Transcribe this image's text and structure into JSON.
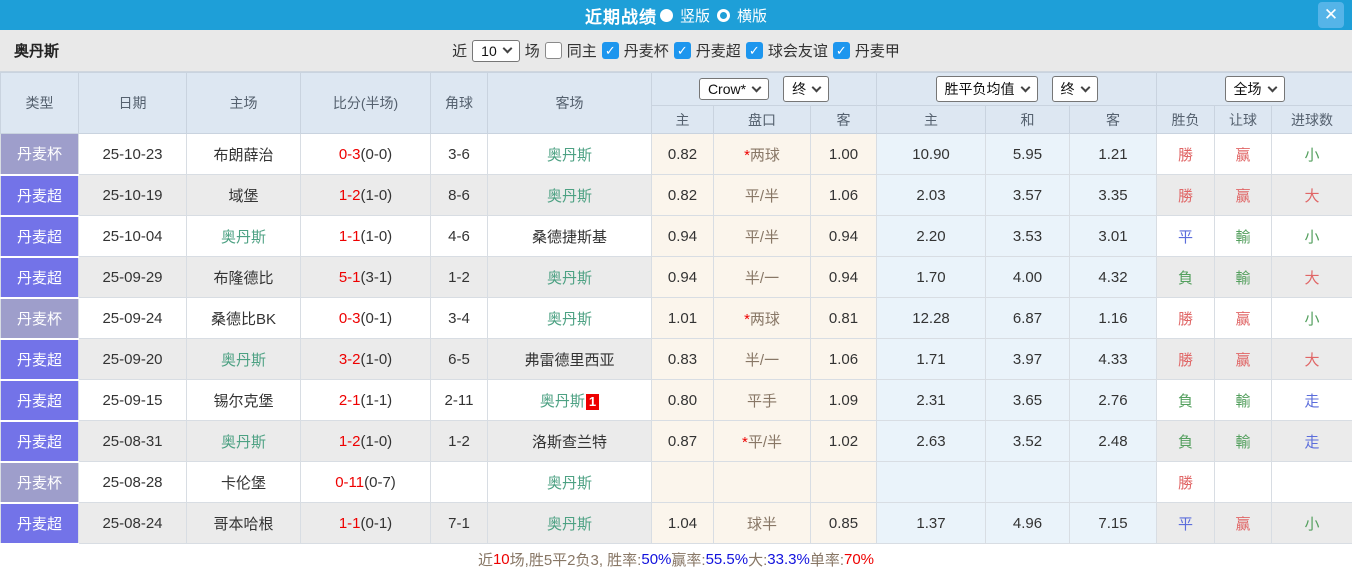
{
  "topbar": {
    "title": "近期战绩",
    "radio_vertical_label": "竖版",
    "radio_horizontal_label": "横版",
    "close_glyph": "✕"
  },
  "filter": {
    "team": "奥丹斯",
    "near_label": "近",
    "matches_value": "10",
    "matches_label": "场",
    "same_home_label": "同主",
    "league_checkboxes": [
      "丹麦杯",
      "丹麦超",
      "球会友谊",
      "丹麦甲"
    ],
    "check_glyph": "✓"
  },
  "table": {
    "left_headers": [
      "类型",
      "日期",
      "主场",
      "比分(半场)",
      "角球",
      "客场"
    ],
    "dropdowns": {
      "asia_company": "Crow*",
      "asia_time": "终",
      "europe_company": "胜平负均值",
      "europe_time": "终",
      "scope": "全场"
    },
    "sub_headers": [
      "主",
      "盘口",
      "客",
      "主",
      "和",
      "客",
      "胜负",
      "让球",
      "进球数"
    ],
    "rows": [
      {
        "type": "丹麦杯",
        "type_color": "#9e9ecb",
        "date": "25-10-23",
        "home": "布朗薛治",
        "home_team": false,
        "score": "0-3",
        "half": "(0-0)",
        "corner": "3-6",
        "away": "奥丹斯",
        "away_team": true,
        "away_badge": "",
        "asia_home": "0.82",
        "handicap": "*两球",
        "asia_away": "1.00",
        "eu_home": "10.90",
        "eu_draw": "5.95",
        "eu_away": "1.21",
        "result": "勝",
        "result_cls": "red",
        "handi_res": "赢",
        "handi_cls": "red",
        "goal_res": "小",
        "goal_cls": "green"
      },
      {
        "type": "丹麦超",
        "type_color": "#7373e8",
        "date": "25-10-19",
        "home": "域堡",
        "home_team": false,
        "score": "1-2",
        "half": "(1-0)",
        "corner": "8-6",
        "away": "奥丹斯",
        "away_team": true,
        "away_badge": "",
        "asia_home": "0.82",
        "handicap": "平/半",
        "asia_away": "1.06",
        "eu_home": "2.03",
        "eu_draw": "3.57",
        "eu_away": "3.35",
        "result": "勝",
        "result_cls": "red",
        "handi_res": "赢",
        "handi_cls": "red",
        "goal_res": "大",
        "goal_cls": "red"
      },
      {
        "type": "丹麦超",
        "type_color": "#7373e8",
        "date": "25-10-04",
        "home": "奥丹斯",
        "home_team": true,
        "score": "1-1",
        "half": "(1-0)",
        "corner": "4-6",
        "away": "桑德捷斯基",
        "away_team": false,
        "away_badge": "",
        "asia_home": "0.94",
        "handicap": "平/半",
        "asia_away": "0.94",
        "eu_home": "2.20",
        "eu_draw": "3.53",
        "eu_away": "3.01",
        "result": "平",
        "result_cls": "blue",
        "handi_res": "輸",
        "handi_cls": "green",
        "goal_res": "小",
        "goal_cls": "green"
      },
      {
        "type": "丹麦超",
        "type_color": "#7373e8",
        "date": "25-09-29",
        "home": "布隆德比",
        "home_team": false,
        "score": "5-1",
        "half": "(3-1)",
        "corner": "1-2",
        "away": "奥丹斯",
        "away_team": true,
        "away_badge": "",
        "asia_home": "0.94",
        "handicap": "半/一",
        "asia_away": "0.94",
        "eu_home": "1.70",
        "eu_draw": "4.00",
        "eu_away": "4.32",
        "result": "負",
        "result_cls": "green",
        "handi_res": "輸",
        "handi_cls": "green",
        "goal_res": "大",
        "goal_cls": "red"
      },
      {
        "type": "丹麦杯",
        "type_color": "#9e9ecb",
        "date": "25-09-24",
        "home": "桑德比BK",
        "home_team": false,
        "score": "0-3",
        "half": "(0-1)",
        "corner": "3-4",
        "away": "奥丹斯",
        "away_team": true,
        "away_badge": "",
        "asia_home": "1.01",
        "handicap": "*两球",
        "asia_away": "0.81",
        "eu_home": "12.28",
        "eu_draw": "6.87",
        "eu_away": "1.16",
        "result": "勝",
        "result_cls": "red",
        "handi_res": "赢",
        "handi_cls": "red",
        "goal_res": "小",
        "goal_cls": "green"
      },
      {
        "type": "丹麦超",
        "type_color": "#7373e8",
        "date": "25-09-20",
        "home": "奥丹斯",
        "home_team": true,
        "score": "3-2",
        "half": "(1-0)",
        "corner": "6-5",
        "away": "弗雷德里西亚",
        "away_team": false,
        "away_badge": "",
        "asia_home": "0.83",
        "handicap": "半/一",
        "asia_away": "1.06",
        "eu_home": "1.71",
        "eu_draw": "3.97",
        "eu_away": "4.33",
        "result": "勝",
        "result_cls": "red",
        "handi_res": "赢",
        "handi_cls": "red",
        "goal_res": "大",
        "goal_cls": "red"
      },
      {
        "type": "丹麦超",
        "type_color": "#7373e8",
        "date": "25-09-15",
        "home": "锡尔克堡",
        "home_team": false,
        "score": "2-1",
        "half": "(1-1)",
        "corner": "2-11",
        "away": "奥丹斯",
        "away_team": true,
        "away_badge": "1",
        "asia_home": "0.80",
        "handicap": "平手",
        "asia_away": "1.09",
        "eu_home": "2.31",
        "eu_draw": "3.65",
        "eu_away": "2.76",
        "result": "負",
        "result_cls": "green",
        "handi_res": "輸",
        "handi_cls": "green",
        "goal_res": "走",
        "goal_cls": "blue"
      },
      {
        "type": "丹麦超",
        "type_color": "#7373e8",
        "date": "25-08-31",
        "home": "奥丹斯",
        "home_team": true,
        "score": "1-2",
        "half": "(1-0)",
        "corner": "1-2",
        "away": "洛斯查兰特",
        "away_team": false,
        "away_badge": "",
        "asia_home": "0.87",
        "handicap": "*平/半",
        "asia_away": "1.02",
        "eu_home": "2.63",
        "eu_draw": "3.52",
        "eu_away": "2.48",
        "result": "負",
        "result_cls": "green",
        "handi_res": "輸",
        "handi_cls": "green",
        "goal_res": "走",
        "goal_cls": "blue"
      },
      {
        "type": "丹麦杯",
        "type_color": "#9e9ecb",
        "date": "25-08-28",
        "home": "卡伦堡",
        "home_team": false,
        "score": "0-11",
        "half": "(0-7)",
        "corner": "",
        "away": "奥丹斯",
        "away_team": true,
        "away_badge": "",
        "asia_home": "",
        "handicap": "",
        "asia_away": "",
        "eu_home": "",
        "eu_draw": "",
        "eu_away": "",
        "result": "勝",
        "result_cls": "red",
        "handi_res": "",
        "handi_cls": "red",
        "goal_res": "",
        "goal_cls": "green"
      },
      {
        "type": "丹麦超",
        "type_color": "#7373e8",
        "date": "25-08-24",
        "home": "哥本哈根",
        "home_team": false,
        "score": "1-1",
        "half": "(0-1)",
        "corner": "7-1",
        "away": "奥丹斯",
        "away_team": true,
        "away_badge": "",
        "asia_home": "1.04",
        "handicap": "球半",
        "asia_away": "0.85",
        "eu_home": "1.37",
        "eu_draw": "4.96",
        "eu_away": "7.15",
        "result": "平",
        "result_cls": "blue",
        "handi_res": "赢",
        "handi_cls": "red",
        "goal_res": "小",
        "goal_cls": "green"
      }
    ]
  },
  "summary": {
    "segments": [
      {
        "t": "近",
        "c": "m"
      },
      {
        "t": "10",
        "c": "r"
      },
      {
        "t": "场,胜5平2负3, 胜率:",
        "c": "m"
      },
      {
        "t": "50%",
        "c": "b"
      },
      {
        "t": " 赢率:",
        "c": "m"
      },
      {
        "t": "55.5%",
        "c": "b"
      },
      {
        "t": " 大:",
        "c": "m"
      },
      {
        "t": "33.3%",
        "c": "b"
      },
      {
        "t": " 单率:",
        "c": "m"
      },
      {
        "t": "70%",
        "c": "r"
      }
    ]
  },
  "colors": {
    "topbar_blue": "#1e9fd8",
    "cup_badge": "#9e9ecb",
    "league_badge": "#7373e8",
    "team_green": "#4da183",
    "score_red": "#ee0000",
    "win_red": "#e06666",
    "draw_blue": "#5b6ddb",
    "loss_green": "#55a05f"
  }
}
